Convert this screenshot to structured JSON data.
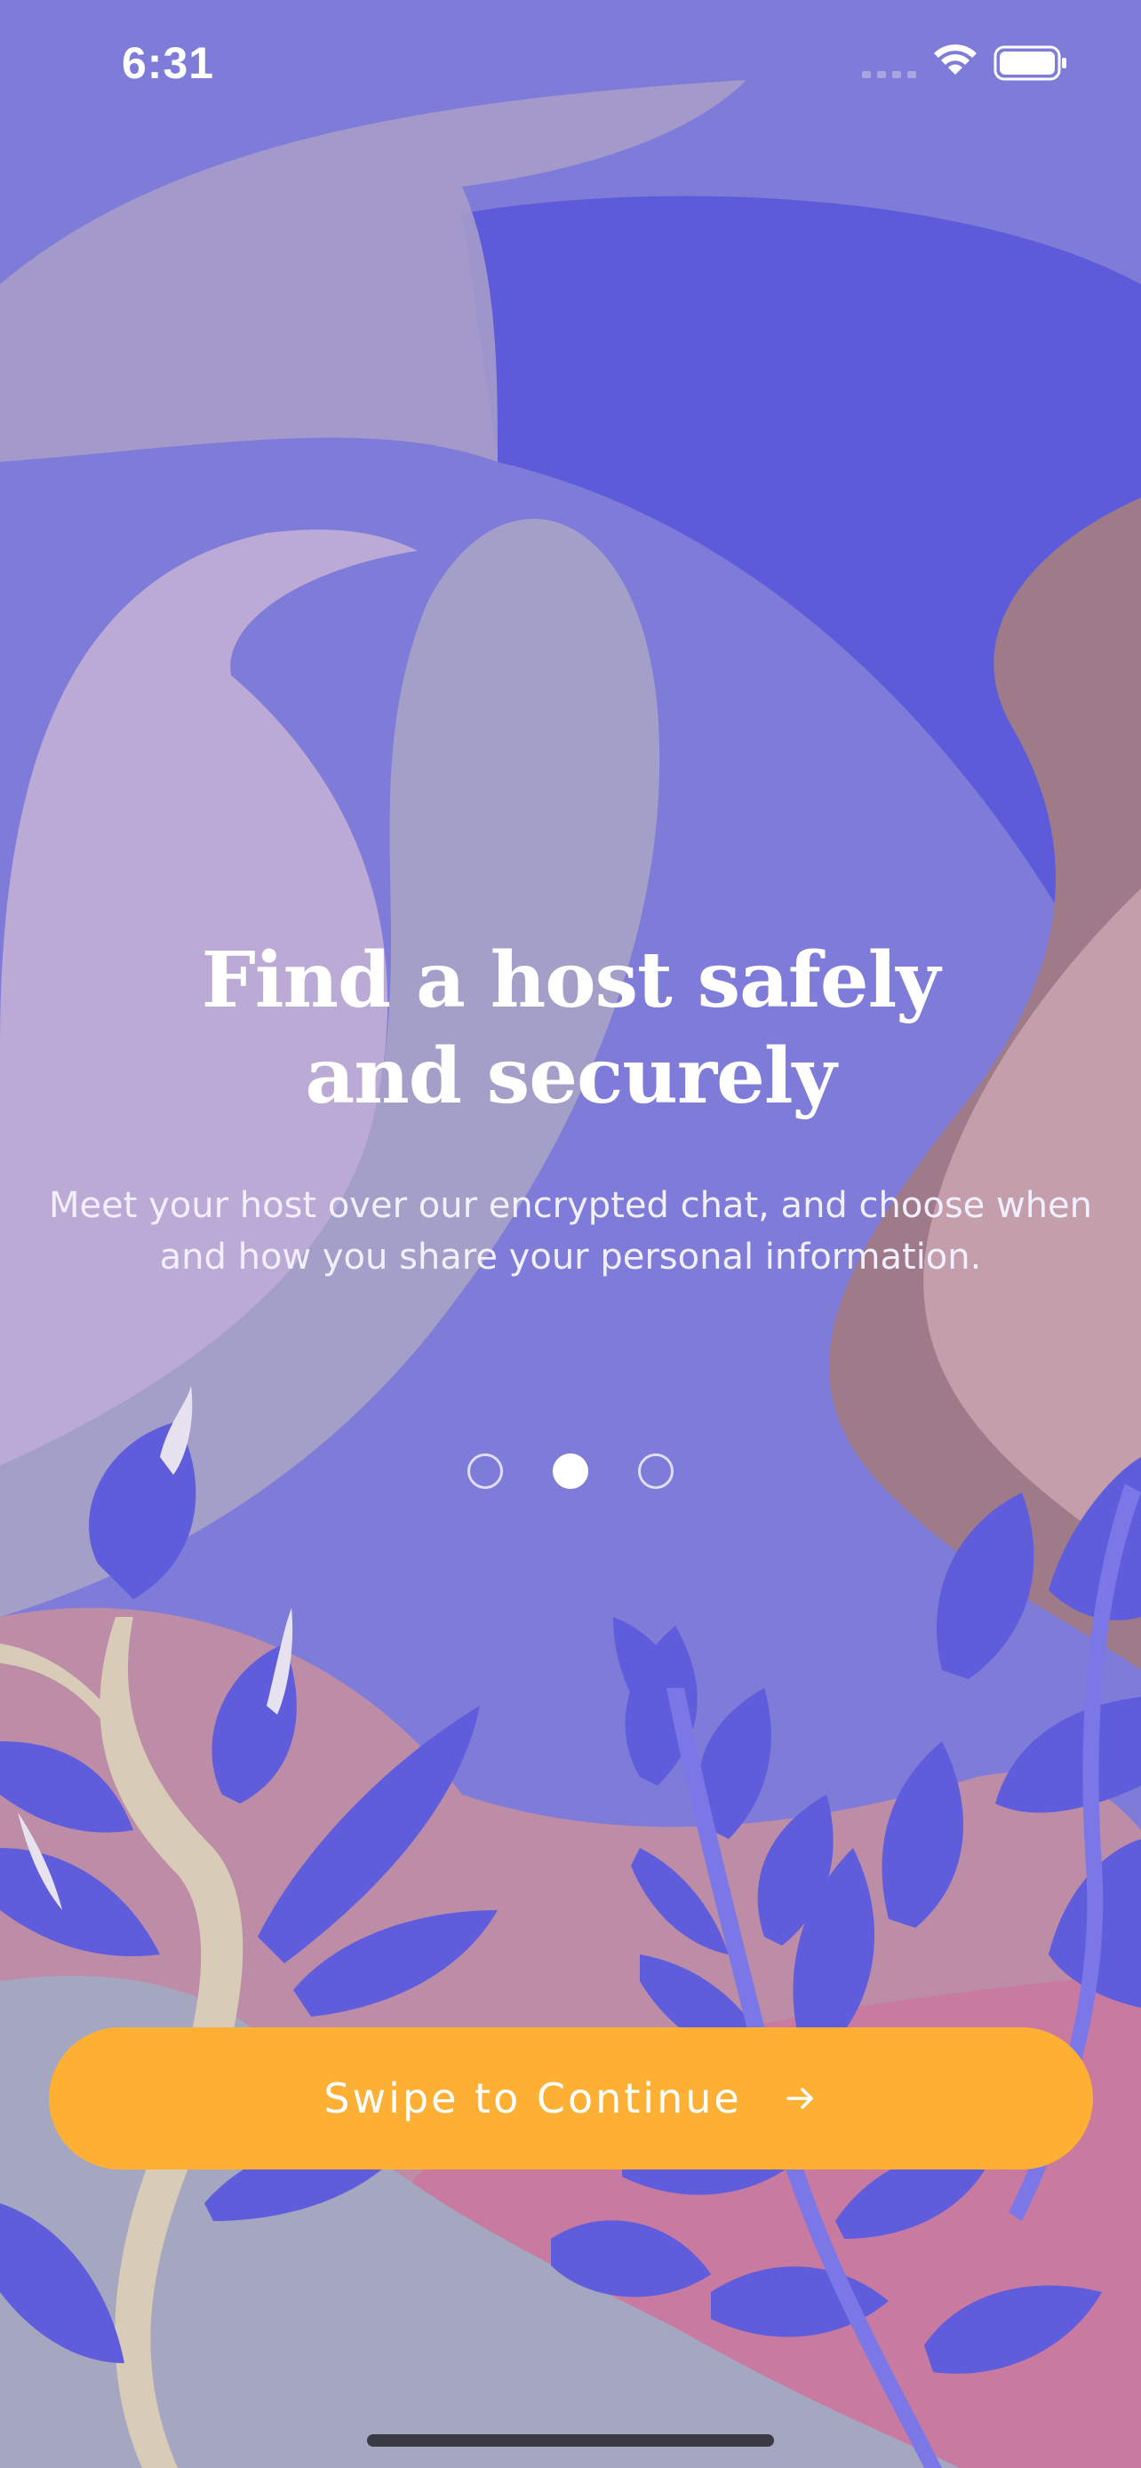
{
  "status_bar": {
    "time": "6:31",
    "icons": [
      "signal-icon",
      "wifi-icon",
      "battery-icon"
    ]
  },
  "onboarding": {
    "title": "Find a host safely and securely",
    "subtitle": "Meet your host over our encrypted chat, and choose when and how you share your personal information.",
    "pager": {
      "total": 3,
      "active": 2
    }
  },
  "cta": {
    "label": "Swipe to Continue",
    "icon": "arrow-right-icon"
  },
  "colors": {
    "background": "#7f7bd9",
    "accent": "#fdb034",
    "leaf": "#5f5ddb",
    "pink": "#c48aa3",
    "text": "#ffffff"
  }
}
